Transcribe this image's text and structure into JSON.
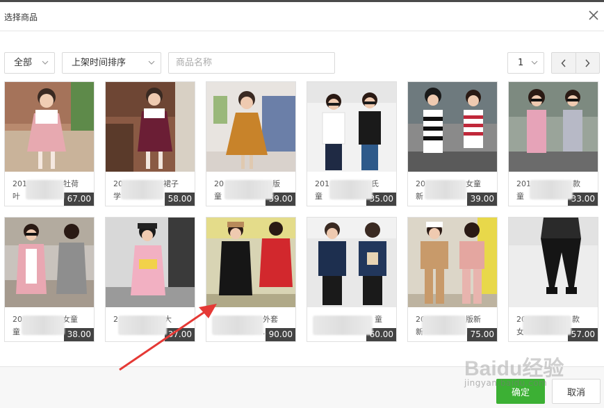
{
  "dialog": {
    "title": "选择商品"
  },
  "toolbar": {
    "category_select": "全部",
    "sort_select": "上架时间排序",
    "search_placeholder": "商品名称",
    "page_select": "1"
  },
  "products": [
    {
      "price": "67.00",
      "name_line1": "201",
      "name_line1_end": "牡荷",
      "name_line2": "叶",
      "name_line2_end": "…"
    },
    {
      "price": "58.00",
      "name_line1": "20",
      "name_line1_end": "裙子",
      "name_line2": "学",
      "name_line2_end": "…"
    },
    {
      "price": "59.00",
      "name_line1": "20",
      "name_line1_end": "版",
      "name_line2": "童",
      "name_line2_end": "…"
    },
    {
      "price": "35.00",
      "name_line1": "201",
      "name_line1_end": "氏",
      "name_line2": "童",
      "name_line2_end": "…"
    },
    {
      "price": "39.00",
      "name_line1": "20",
      "name_line1_end": "女童",
      "name_line2": "新",
      "name_line2_end": "…"
    },
    {
      "price": "33.00",
      "name_line1": "201",
      "name_line1_end": "款",
      "name_line2": "童",
      "name_line2_end": "…"
    },
    {
      "price": "38.00",
      "name_line1": "20",
      "name_line1_end": "女童",
      "name_line2": "童",
      "name_line2_end": "…"
    },
    {
      "price": "37.00",
      "name_line1": "2",
      "name_line1_end": "大",
      "name_line2": "",
      "name_line2_end": ""
    },
    {
      "price": "90.00",
      "name_line1": "",
      "name_line1_end": "外套",
      "name_line2": "",
      "name_line2_end": "…"
    },
    {
      "price": "60.00",
      "name_line1": "",
      "name_line1_end": "童",
      "name_line2": "",
      "name_line2_end": ""
    },
    {
      "price": "75.00",
      "name_line1": "20",
      "name_line1_end": "版新",
      "name_line2": "新",
      "name_line2_end": "…"
    },
    {
      "price": "57.00",
      "name_line1": "20",
      "name_line1_end": "款",
      "name_line2": "女",
      "name_line2_end": "…"
    }
  ],
  "footer": {
    "confirm_label": "确定",
    "cancel_label": "取消"
  },
  "watermark": {
    "brand": "Baidu经验",
    "url": "jingyan.baidu.com"
  },
  "colors": {
    "confirm_green": "#3cb034",
    "annotation_arrow": "#e53935"
  }
}
